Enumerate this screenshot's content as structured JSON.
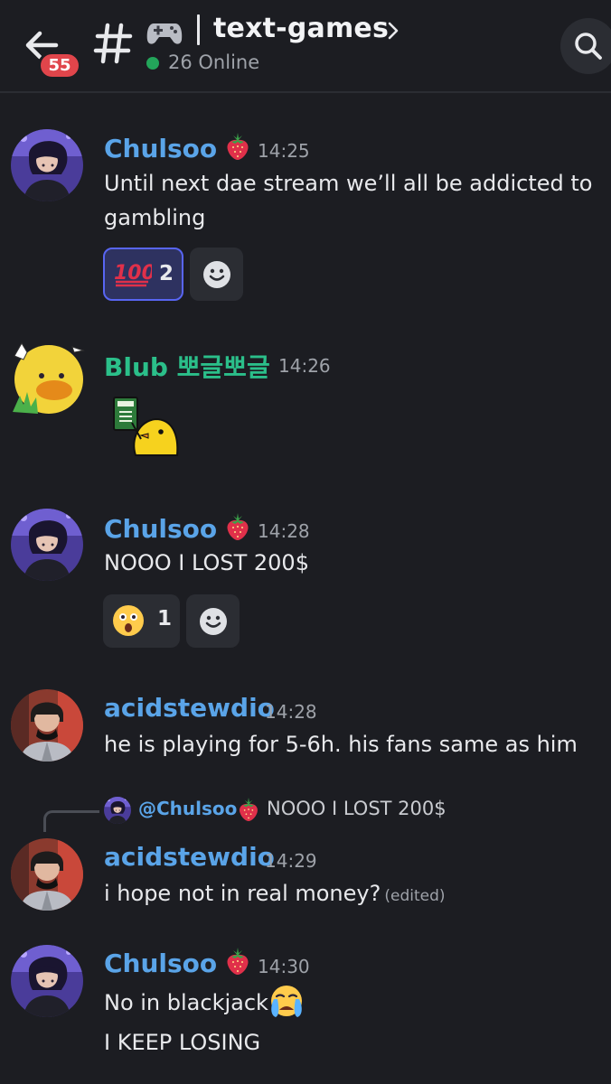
{
  "header": {
    "unread_count": "55",
    "channel_name": "text-games",
    "online_status": "26 Online",
    "icons": [
      "back-arrow-icon",
      "hash-icon",
      "gamepad-icon",
      "chevron-right-icon",
      "search-icon"
    ]
  },
  "colors": {
    "background": "#1c1d22",
    "author_blue": "#5aa4e8",
    "author_green": "#2bbf8a",
    "online_green": "#23a55a",
    "badge_red": "#e0454b",
    "reaction_active": "#5865f2"
  },
  "messages": [
    {
      "author": "Chulsoo",
      "role_icon": "strawberry-icon",
      "time": "14:25",
      "text": "Until next dae stream we’ll all be addicted to gambling",
      "reactions": [
        {
          "emoji": "100-icon",
          "count": "2",
          "active": true
        }
      ]
    },
    {
      "author": "Blub 뽀글뽀글",
      "time": "14:26",
      "sticker": "chick-money-sticker"
    },
    {
      "author": "Chulsoo",
      "role_icon": "strawberry-icon",
      "time": "14:28",
      "text": "NOOO I LOST 200$",
      "reactions": [
        {
          "emoji": "astonished-face-icon",
          "count": "1",
          "active": false
        }
      ]
    },
    {
      "author": "acidstewdio",
      "time": "14:28",
      "text": "he is playing for 5-6h. his fans same as him"
    },
    {
      "reply_to": {
        "author": "@Chulsoo",
        "text": "NOOO I LOST 200$"
      },
      "author": "acidstewdio",
      "time": "14:29",
      "text": "i hope not in real money?",
      "edited": "(edited)"
    },
    {
      "author": "Chulsoo",
      "role_icon": "strawberry-icon",
      "time": "14:30",
      "text": "No in blackjack",
      "trailing_emoji": "crying-face-icon",
      "text_line2": "I KEEP LOSING"
    }
  ]
}
